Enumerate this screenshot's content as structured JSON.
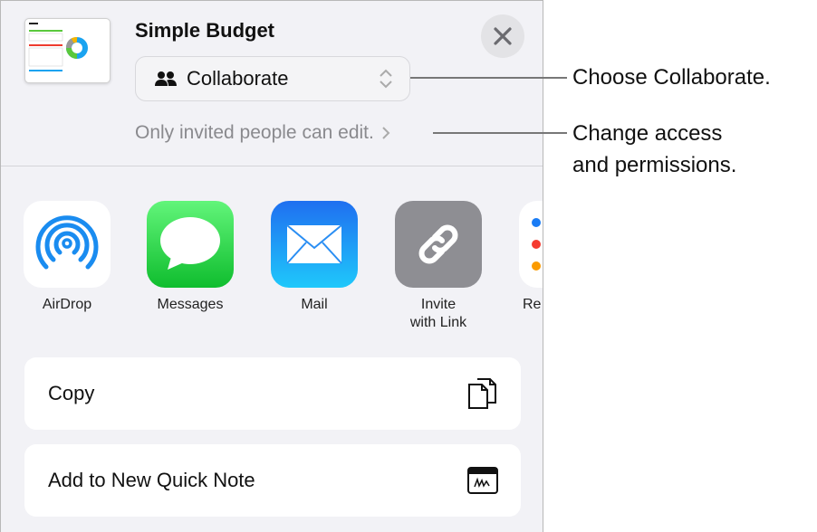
{
  "document": {
    "title": "Simple Budget",
    "thumbnail_icon": "budget-spreadsheet-thumbnail"
  },
  "share_mode": {
    "selected": "Collaborate",
    "icon": "people-icon"
  },
  "access_text": "Only invited people can edit.",
  "apps": [
    {
      "label": "AirDrop",
      "icon": "airdrop-icon",
      "color": "#1a8cf0"
    },
    {
      "label": "Messages",
      "icon": "messages-icon",
      "color": "#27c53f"
    },
    {
      "label": "Mail",
      "icon": "mail-icon",
      "color": "#1f8ef5"
    },
    {
      "label_line1": "Invite",
      "label_line2": "with Link",
      "icon": "link-icon",
      "color": "#8e8e93"
    },
    {
      "label": "Re",
      "icon": "reminders-icon"
    }
  ],
  "actions": [
    {
      "label": "Copy",
      "icon": "copy-icon"
    },
    {
      "label": "Add to New Quick Note",
      "icon": "quick-note-icon"
    }
  ],
  "callouts": {
    "collaborate": "Choose Collaborate.",
    "access_line1": "Change access",
    "access_line2": "and permissions."
  }
}
